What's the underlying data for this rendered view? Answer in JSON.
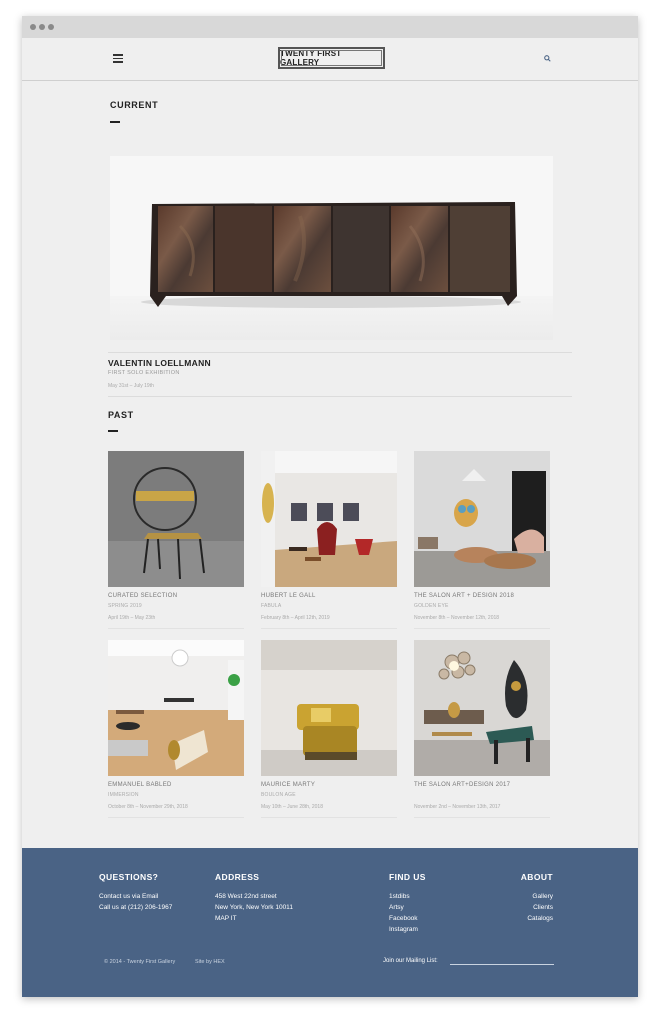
{
  "header": {
    "logo": "TWENTY FIRST GALLERY",
    "menu_icon": "hamburger-icon",
    "search_icon": "search-icon"
  },
  "current": {
    "section_title": "CURRENT",
    "exhibition": {
      "artist": "VALENTIN LOELLMANN",
      "subtitle": "FIRST SOLO EXHIBITION",
      "dates": "May 31st – July 19th"
    }
  },
  "past": {
    "section_title": "PAST",
    "items": [
      {
        "artist": "CURATED SELECTION",
        "subtitle": "SPRING 2019",
        "dates": "April 19th – May 23th"
      },
      {
        "artist": "HUBERT LE GALL",
        "subtitle": "FABULA",
        "dates": "February 8th – April 12th, 2019"
      },
      {
        "artist": "THE SALON ART + DESIGN 2018",
        "subtitle": "GOLDEN EYE",
        "dates": "November 8th – November 12th, 2018"
      },
      {
        "artist": "EMMANUEL BABLED",
        "subtitle": "IMMERSION",
        "dates": "October 8th – November 29th, 2018"
      },
      {
        "artist": "MAURICE MARTY",
        "subtitle": "BOULON AGE",
        "dates": "May 10th – June 28th, 2018"
      },
      {
        "artist": "THE SALON ART+DESIGN 2017",
        "subtitle": "",
        "dates": "November 2nd – November 13th, 2017"
      }
    ]
  },
  "footer": {
    "questions": {
      "heading": "QUESTIONS?",
      "lines": [
        "Contact us via Email",
        "Call us at (212) 206-1967"
      ]
    },
    "address": {
      "heading": "ADDRESS",
      "lines": [
        "458 West 22nd street",
        "New York, New York 10011",
        "MAP IT"
      ]
    },
    "find_us": {
      "heading": "FIND US",
      "links": [
        "1stdibs",
        "Artsy",
        "Facebook",
        "Instagram"
      ]
    },
    "about": {
      "heading": "ABOUT",
      "links": [
        "Gallery",
        "Clients",
        "Catalogs"
      ]
    },
    "copyright": "© 2014 - Twenty First Gallery",
    "site_by": "Site by HEX",
    "mailing_label": "Join our Mailing List:"
  },
  "colors": {
    "footer_bg": "#4a6385",
    "page_bg": "#efefef"
  }
}
